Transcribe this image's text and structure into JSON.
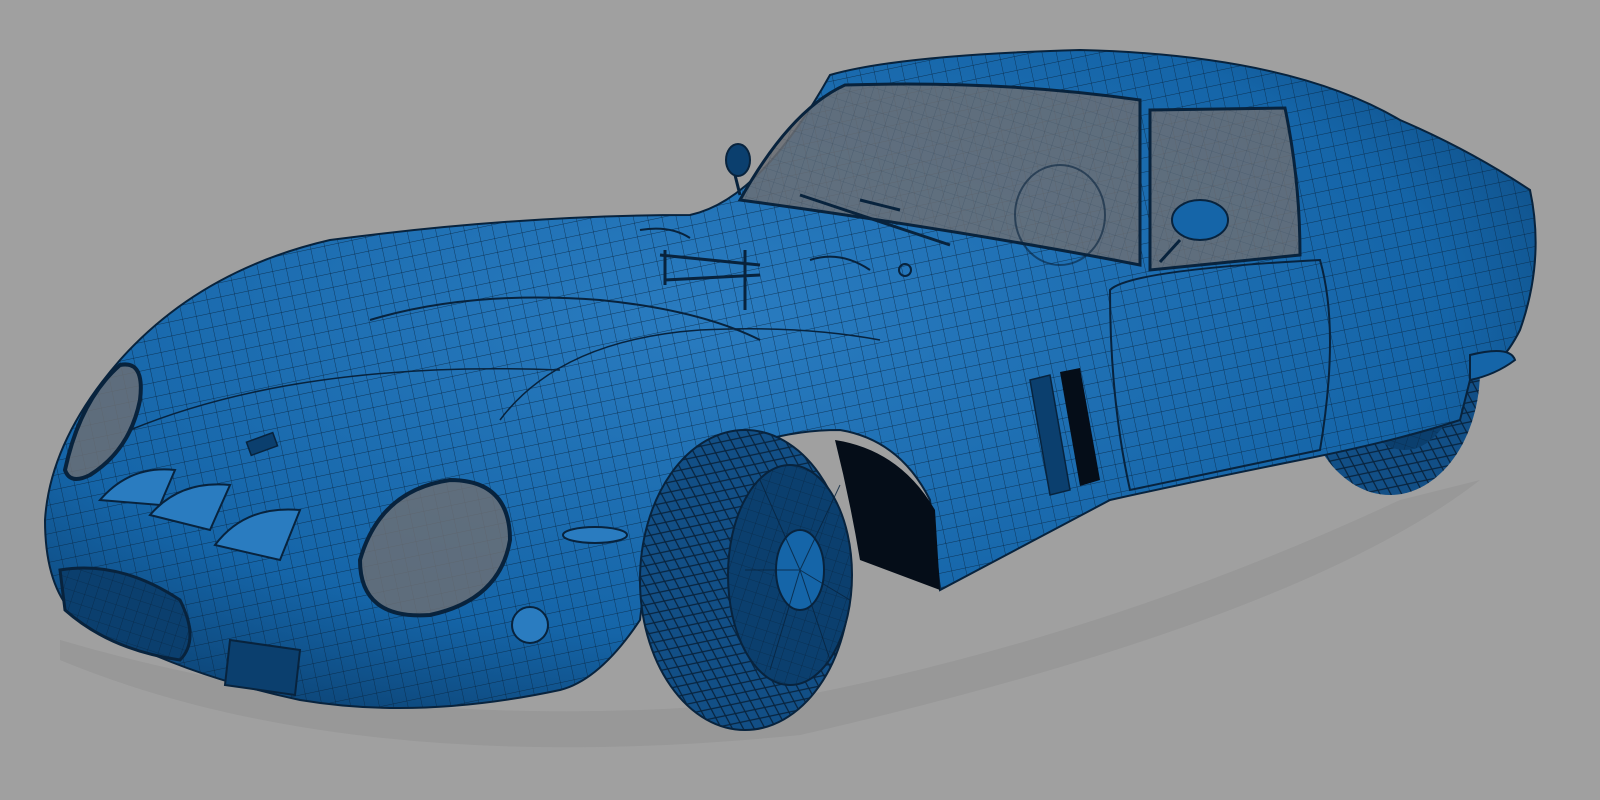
{
  "scene": {
    "background_color": "#a0a0a0",
    "model_color": "#1565a8",
    "model_shadow_color": "#0b3f6e",
    "model_highlight_color": "#2a7cc0",
    "wireframe_color": "#08233d",
    "glass_color": "#6b6f74",
    "tire_color": "#124f86",
    "model_name_icon": "sports-car-wireframe-model"
  }
}
